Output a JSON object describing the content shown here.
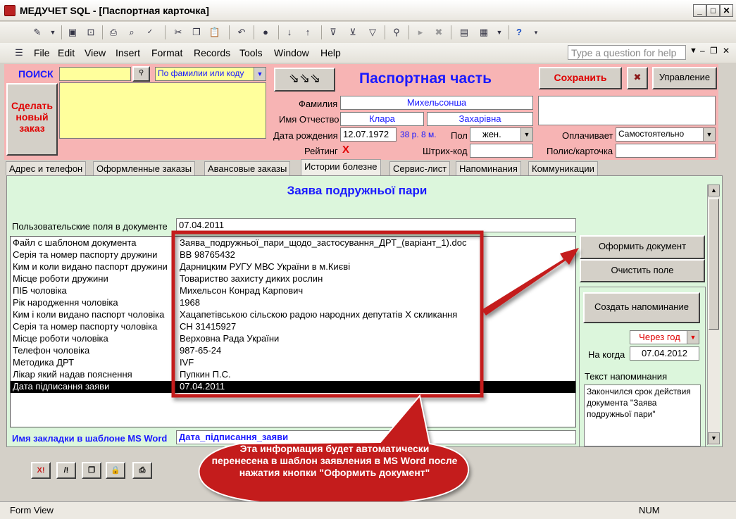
{
  "window": {
    "title": "МЕДУЧЕТ SQL - [Паспортная карточка]"
  },
  "menu": {
    "items": [
      "File",
      "Edit",
      "View",
      "Insert",
      "Format",
      "Records",
      "Tools",
      "Window",
      "Help"
    ],
    "help_placeholder": "Type a question for help"
  },
  "header": {
    "search_label": "ПОИСК",
    "search_mode": "По фамилии или коду",
    "new_order_button": "Сделать новый заказ",
    "section_title": "Паспортная часть",
    "save_button": "Сохранить",
    "manage_button": "Управление",
    "surname_label": "Фамилия",
    "surname": "Михельсонша",
    "name_label": "Имя Отчество",
    "first_name": "Клара",
    "patronymic": "Захарівна",
    "dob_label": "Дата рождения",
    "dob": "12.07.1972",
    "age": "38 р. 8 м.",
    "gender_label": "Пол",
    "gender": "жен.",
    "rating_label": "Рейтинг",
    "rating_value": "X",
    "barcode_label": "Штрих-код",
    "payer_label": "Оплачивает",
    "payer": "Самостоятельно",
    "policy_label": "Полис/карточка"
  },
  "tabs": [
    {
      "label": "Адрес и телефон"
    },
    {
      "label": "Оформленные заказы"
    },
    {
      "label": "Авансовые заказы"
    },
    {
      "label": "Истории болезне"
    },
    {
      "label": "Сервис-лист"
    },
    {
      "label": "Напоминания"
    },
    {
      "label": "Коммуникации"
    }
  ],
  "document": {
    "title": "Заява подружньої пари",
    "user_fields_label": "Пользовательские поля в документе",
    "user_fields_value": "07.04.2011",
    "rows": [
      {
        "key": "Файл с шаблоном документа",
        "value": "Заява_подружньої_пари_щодо_застосування_ДРТ_(варіант_1).doc"
      },
      {
        "key": "Серія та номер паспорту дружини",
        "value": "ВВ 98765432"
      },
      {
        "key": "Ким и коли видано паспорт дружини",
        "value": "Дарницким РУГУ МВС України в м.Києві"
      },
      {
        "key": "Місце роботи дружини",
        "value": "Товариство захисту диких рослин"
      },
      {
        "key": "ПІБ чоловіка",
        "value": "Михельсон Конрад Карпович"
      },
      {
        "key": "Рік народження чоловіка",
        "value": "1968"
      },
      {
        "key": "Ким і коли видано паспорт чоловіка",
        "value": "Хацапетівською сільскою радою народних депутатів X скликання"
      },
      {
        "key": "Серія та номер паспорту чоловіка",
        "value": "СН 31415927"
      },
      {
        "key": "Місце роботи чоловіка",
        "value": "Верховна Рада України"
      },
      {
        "key": "Телефон чоловіка",
        "value": "987-65-24"
      },
      {
        "key": "Методика ДРТ",
        "value": "IVF"
      },
      {
        "key": "Лікар який надав пояснення",
        "value": "Пупкин П.С."
      },
      {
        "key": "Дата підписання заяви",
        "value": "07.04.2011"
      }
    ],
    "bookmark_label": "Имя закладки в шаблоне MS Word",
    "bookmark_value": "Дата_підписання_заяви",
    "make_document_button": "Оформить документ",
    "clear_field_button": "Очистить поле",
    "create_reminder_button": "Создать напоминание",
    "reminder_interval": "Через год",
    "when_label": "На когда",
    "when_value": "07.04.2012",
    "reminder_text_label": "Текст напоминания",
    "reminder_text": "Закончился срок действия документа \"Заява подружньої пари\""
  },
  "callout": {
    "text": "Эта информация будет автоматически перенесена в шаблон заявления в MS Word после нажатия кнопки \"Оформить документ\""
  },
  "bottom_buttons": [
    "X!",
    "/!"
  ],
  "status": {
    "view": "Form View",
    "num": "NUM"
  },
  "colors": {
    "header_bg": "#f7b4b4",
    "panel_bg": "#dcf6dc",
    "search_bg": "#ffff9c",
    "accent_blue": "#1a1aff",
    "accent_red": "#e00000",
    "callout_red": "#c41e1e"
  }
}
